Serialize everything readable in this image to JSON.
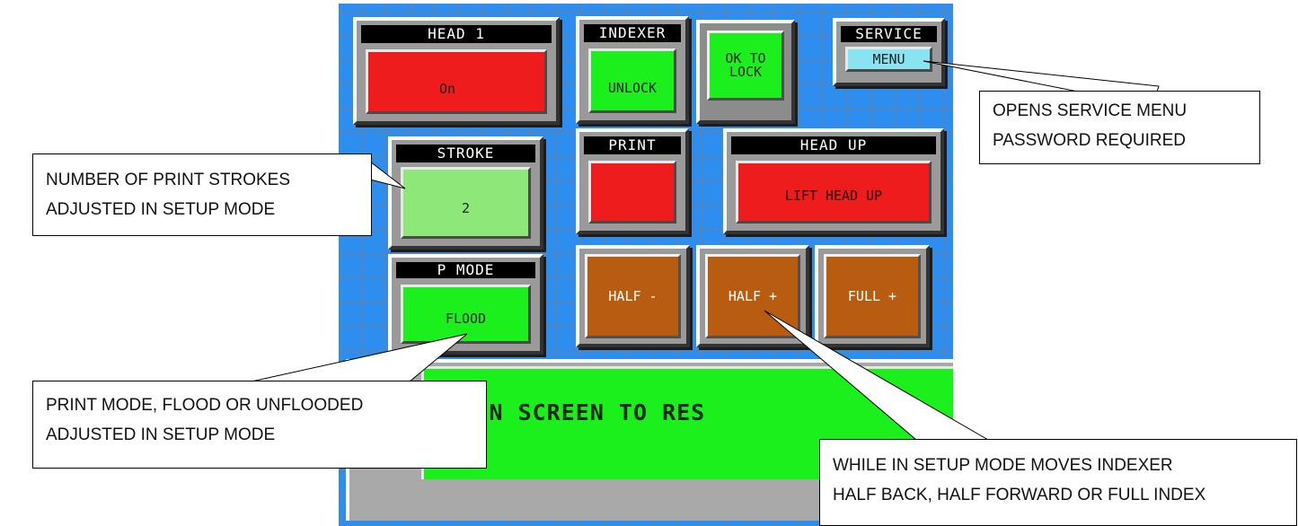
{
  "hmi": {
    "head1": {
      "label": "HEAD 1",
      "value": "On"
    },
    "indexer": {
      "label": "INDEXER",
      "value": "UNLOCK"
    },
    "ok_to_lock": {
      "line1": "OK TO",
      "line2": "LOCK"
    },
    "service": {
      "label": "SERVICE",
      "value": "MENU"
    },
    "stroke": {
      "label": "STROKE",
      "value": "2"
    },
    "print": {
      "label": "PRINT"
    },
    "head_up": {
      "label": "HEAD UP",
      "value": "LIFT HEAD UP"
    },
    "p_mode": {
      "label": "P MODE",
      "value": "FLOOD"
    },
    "half_minus": "HALF -",
    "half_plus": "HALF +",
    "full_plus": "FULL +",
    "message": "S FOR MAIN SCREEN TO RES"
  },
  "callouts": {
    "service": {
      "line1": "OPENS SERVICE MENU",
      "line2": "PASSWORD REQUIRED"
    },
    "stroke": {
      "line1": "NUMBER OF PRINT STROKES",
      "line2": "ADJUSTED IN SETUP MODE"
    },
    "pmode": {
      "line1": "PRINT MODE, FLOOD OR UNFLOODED",
      "line2": "ADJUSTED IN SETUP MODE"
    },
    "indexer": {
      "line1": "WHILE IN SETUP MODE MOVES INDEXER",
      "line2": "HALF BACK, HALF FORWARD OR FULL INDEX"
    }
  },
  "colors": {
    "panel_bg": "#2e8ef0",
    "red": "#ee1c1c",
    "green": "#1cf01c",
    "light_green": "#8ee878",
    "brown": "#b85c12",
    "cyan": "#88e4f0"
  }
}
